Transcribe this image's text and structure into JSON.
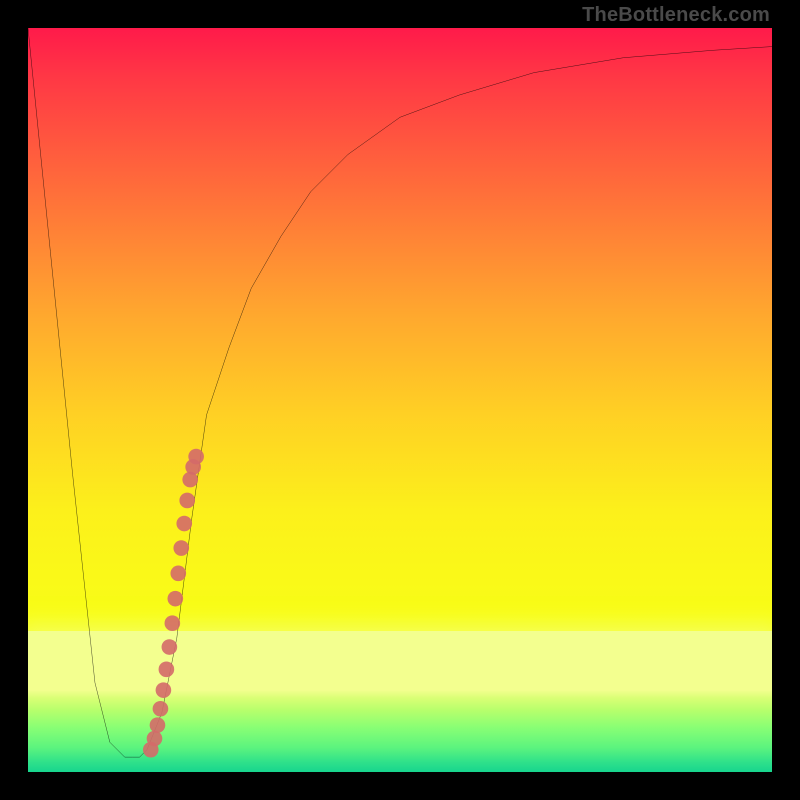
{
  "source_label": "TheBottleneck.com",
  "colors": {
    "top": "#ff1a4a",
    "mid": "#ffd024",
    "band": "#f3ff8f",
    "green": "#17d58e",
    "frame": "#000000",
    "curve": "#000000",
    "dots": "#d46a69"
  },
  "chart_data": {
    "type": "line",
    "title": "",
    "xlabel": "",
    "ylabel": "",
    "xlim": [
      0,
      100
    ],
    "ylim": [
      0,
      100
    ],
    "curve": {
      "x": [
        0,
        3,
        6,
        9,
        11,
        13,
        14,
        15,
        16,
        18,
        20,
        22,
        24,
        27,
        30,
        34,
        38,
        43,
        50,
        58,
        68,
        80,
        92,
        100
      ],
      "y": [
        100,
        70,
        40,
        12,
        4,
        2,
        2,
        2,
        3,
        8,
        18,
        34,
        48,
        57,
        65,
        72,
        78,
        83,
        88,
        91,
        94,
        96,
        97,
        97.5
      ]
    },
    "series": [
      {
        "name": "dots",
        "type": "scatter",
        "x": [
          16.5,
          17.0,
          17.4,
          17.8,
          18.2,
          18.6,
          19.0,
          19.4,
          19.8,
          20.2,
          20.6,
          21.0,
          21.4,
          21.8,
          22.2,
          22.6
        ],
        "y": [
          3.0,
          4.5,
          6.3,
          8.5,
          11.0,
          13.8,
          16.8,
          20.0,
          23.3,
          26.7,
          30.1,
          33.4,
          36.5,
          39.3,
          41.0,
          42.4
        ]
      }
    ],
    "note": "Axis values are proportional (0–100) estimates read off the image; the chart has no numeric tick labels."
  }
}
